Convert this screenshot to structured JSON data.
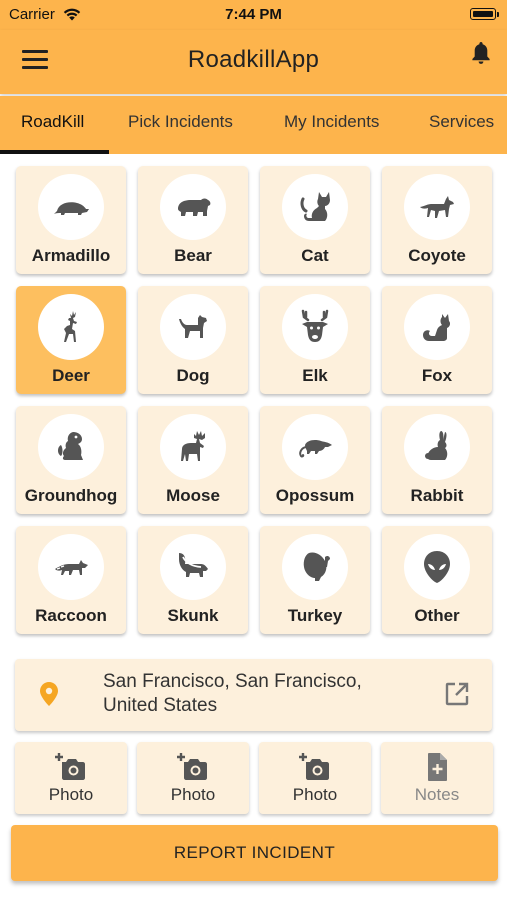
{
  "status_bar": {
    "carrier": "Carrier",
    "time": "7:44 PM"
  },
  "app_bar": {
    "title": "RoadkillApp",
    "menu_icon": "hamburger-menu-icon",
    "notification_icon": "bell-icon"
  },
  "tabs": [
    {
      "label": "RoadKill",
      "active": true
    },
    {
      "label": "Pick Incidents",
      "active": false
    },
    {
      "label": "My Incidents",
      "active": false
    },
    {
      "label": "Services",
      "active": false
    }
  ],
  "animals": [
    {
      "label": "Armadillo",
      "icon": "armadillo-icon",
      "selected": false
    },
    {
      "label": "Bear",
      "icon": "bear-icon",
      "selected": false
    },
    {
      "label": "Cat",
      "icon": "cat-icon",
      "selected": false
    },
    {
      "label": "Coyote",
      "icon": "coyote-icon",
      "selected": false
    },
    {
      "label": "Deer",
      "icon": "deer-icon",
      "selected": true
    },
    {
      "label": "Dog",
      "icon": "dog-icon",
      "selected": false
    },
    {
      "label": "Elk",
      "icon": "elk-icon",
      "selected": false
    },
    {
      "label": "Fox",
      "icon": "fox-icon",
      "selected": false
    },
    {
      "label": "Groundhog",
      "icon": "groundhog-icon",
      "selected": false
    },
    {
      "label": "Moose",
      "icon": "moose-icon",
      "selected": false
    },
    {
      "label": "Opossum",
      "icon": "opossum-icon",
      "selected": false
    },
    {
      "label": "Rabbit",
      "icon": "rabbit-icon",
      "selected": false
    },
    {
      "label": "Raccoon",
      "icon": "raccoon-icon",
      "selected": false
    },
    {
      "label": "Skunk",
      "icon": "skunk-icon",
      "selected": false
    },
    {
      "label": "Turkey",
      "icon": "turkey-icon",
      "selected": false
    },
    {
      "label": "Other",
      "icon": "alien-icon",
      "selected": false
    }
  ],
  "location": {
    "line1": "San Francisco, San Francisco,",
    "line2": "United States",
    "pin_icon": "location-pin-icon",
    "open_icon": "open-external-icon"
  },
  "media_buttons": [
    {
      "label": "Photo",
      "icon": "add-photo-icon"
    },
    {
      "label": "Photo",
      "icon": "add-photo-icon"
    },
    {
      "label": "Photo",
      "icon": "add-photo-icon"
    },
    {
      "label": "Notes",
      "icon": "add-note-icon"
    }
  ],
  "report_button": {
    "label": "REPORT INCIDENT"
  },
  "colors": {
    "primary": "#fdb44c",
    "tile_background": "#fdf0dc",
    "tile_selected": "#fdbf5f",
    "icon": "#555555",
    "pin": "#f5a623"
  }
}
